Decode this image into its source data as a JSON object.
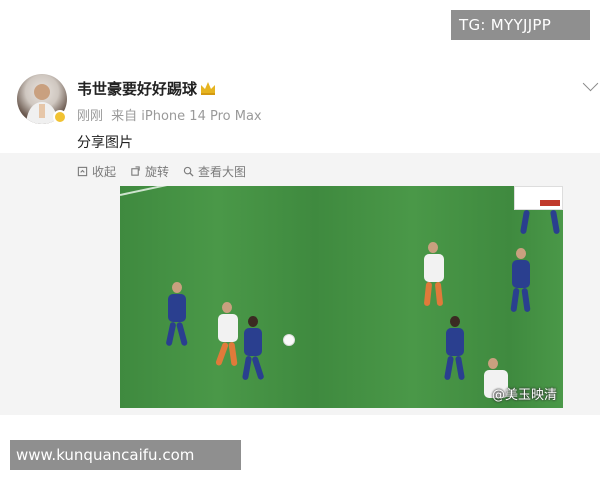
{
  "watermarks": {
    "tg": "TG: MYYJJPP",
    "site": "www.kunquancaifu.com"
  },
  "post": {
    "username": "韦世豪要好好踢球",
    "time": "刚刚",
    "source": "来自 iPhone 14 Pro Max",
    "text": "分享图片",
    "badge_icon": "crown-icon",
    "avatar_badge_icon": "verified-badge-icon"
  },
  "toolbar": {
    "collect": "收起",
    "rotate": "旋转",
    "view_large": "查看大图"
  },
  "image": {
    "overlay_name": "@美玉映清"
  },
  "colors": {
    "username": "#222222",
    "meta": "#9a9a9a",
    "toolbar": "#7a7a7a",
    "watermark_bg": "#8f8f8f",
    "pitch": "#4a9848"
  }
}
